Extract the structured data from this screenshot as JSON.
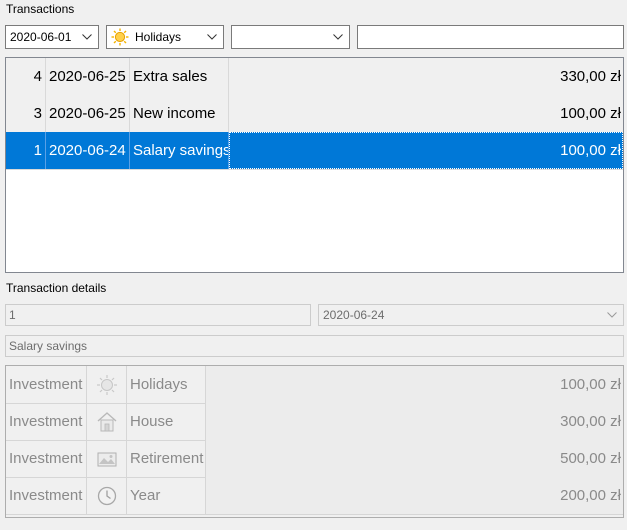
{
  "transactions_section": {
    "title": "Transactions",
    "filters": {
      "date_value": "2020-06-01",
      "category_value": "Holidays",
      "category_icon": "sun-icon",
      "third_combo_value": "",
      "search_value": ""
    },
    "rows": [
      {
        "id": "4",
        "date": "2020-06-25",
        "description": "Extra sales",
        "amount": "330,00 zł",
        "selected": false
      },
      {
        "id": "3",
        "date": "2020-06-25",
        "description": "New income",
        "amount": "100,00 zł",
        "selected": false
      },
      {
        "id": "1",
        "date": "2020-06-24",
        "description": "Salary savings",
        "amount": "100,00 zł",
        "selected": true
      }
    ]
  },
  "details_section": {
    "title": "Transaction details",
    "id_value": "1",
    "date_value": "2020-06-24",
    "description_value": "Salary savings",
    "items": [
      {
        "type": "Investment",
        "icon": "sun-icon",
        "category": "Holidays",
        "amount": "100,00 zł"
      },
      {
        "type": "Investment",
        "icon": "house-icon",
        "category": "House",
        "amount": "300,00 zł"
      },
      {
        "type": "Investment",
        "icon": "picture-icon",
        "category": "Retirement",
        "amount": "500,00 zł"
      },
      {
        "type": "Investment",
        "icon": "clock-icon",
        "category": "Year",
        "amount": "200,00 zł"
      }
    ]
  },
  "colors": {
    "selection": "#0078d7",
    "disabled_text": "#6d6d6d",
    "sun": "#f5b400"
  }
}
